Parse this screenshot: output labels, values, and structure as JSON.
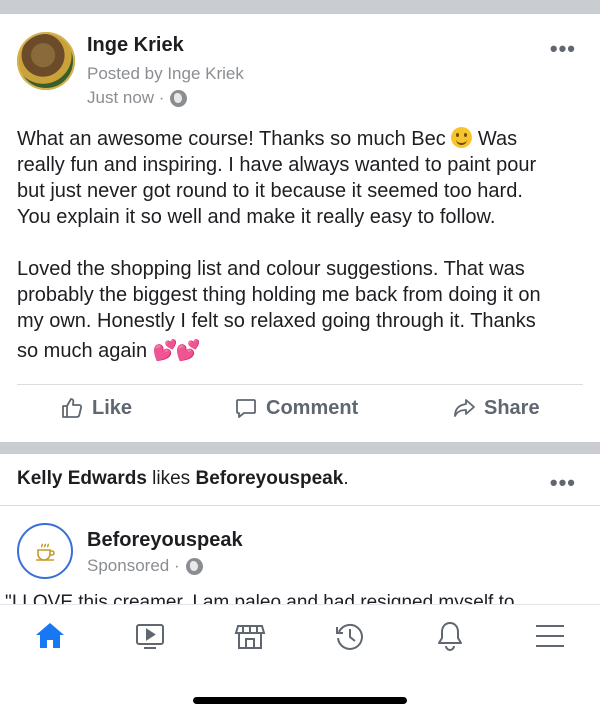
{
  "post": {
    "author": "Inge Kriek",
    "posted_by": "Posted by Inge Kriek",
    "timestamp": "Just now ·",
    "more_label": "•••",
    "para1_a": "What an awesome course! Thanks so much Bec",
    "para1_b": "Was",
    "para1_lines": [
      "really fun and inspiring. I have always wanted to paint pour",
      "but just never got round to it because it seemed too hard.",
      "You explain it so well and make it really easy to follow."
    ],
    "para2_lines": [
      "Loved the shopping list and colour suggestions. That was",
      "probably the biggest thing holding me back from doing it on",
      "my own. Honestly I felt so relaxed going through it. Thanks"
    ],
    "para2_last": "so much again",
    "hearts": "💕💕"
  },
  "actions": {
    "like": "Like",
    "comment": "Comment",
    "share": "Share"
  },
  "activity": {
    "user": "Kelly Edwards",
    "verb": " likes ",
    "page": "Beforeyouspeak",
    "dot": ".",
    "more_label": "•••"
  },
  "ad": {
    "name": "Beforeyouspeak",
    "sponsored": "Sponsored ·",
    "clipped_text": "\"I LOVE this creamer. I am paleo and had resigned myself to"
  },
  "tabbar": {
    "items": [
      "home",
      "watch",
      "marketplace",
      "memories",
      "notifications",
      "menu"
    ],
    "active_color": "#1877f2",
    "inactive_color": "#606770"
  },
  "colors": {
    "separator": "#c9ccd1",
    "muted": "#8a8d91",
    "text": "#1c1e21"
  }
}
